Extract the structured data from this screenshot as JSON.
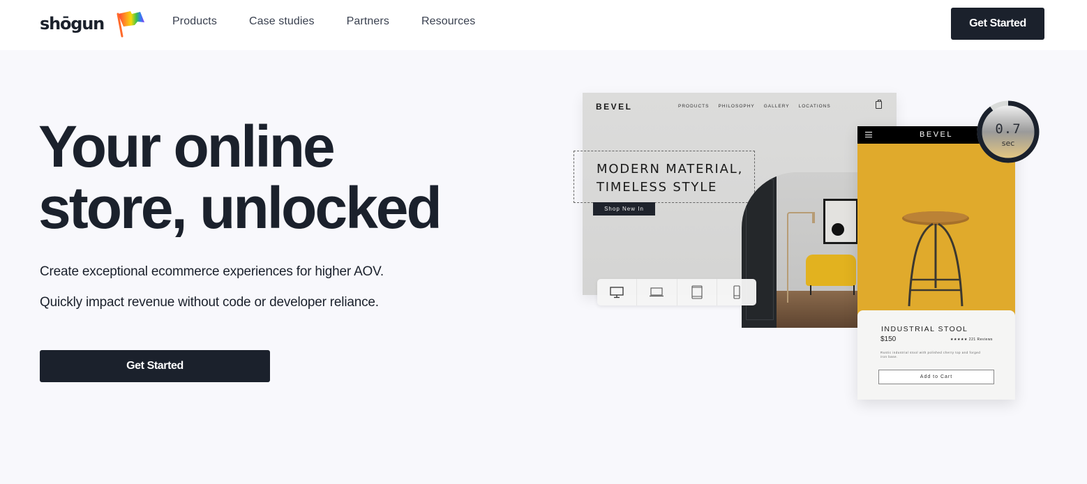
{
  "header": {
    "logo_text": "shōgun",
    "nav": [
      "Products",
      "Case studies",
      "Partners",
      "Resources"
    ],
    "cta_label": "Get Started"
  },
  "hero": {
    "title_line1": "Your online",
    "title_line2": "store, unlocked",
    "subtitle1": "Create exceptional ecommerce experiences for higher AOV.",
    "subtitle2": "Quickly impact revenue without code or developer reliance.",
    "cta_label": "Get Started"
  },
  "desktop_preview": {
    "brand": "BEVEL",
    "nav": [
      "PRODUCTS",
      "PHILOSOPHY",
      "GALLERY",
      "LOCATIONS"
    ],
    "headline_line1": "MODERN MATERIAL,",
    "headline_line2": "TIMELESS STYLE",
    "button_label": "Shop New In",
    "devices": [
      "desktop-icon",
      "laptop-icon",
      "tablet-icon",
      "mobile-icon"
    ]
  },
  "mobile_preview": {
    "brand": "BEVEL",
    "product_name": "INDUSTRIAL STOOL",
    "price": "$150",
    "rating": "★★★★★ 221 Reviews",
    "description": "Rustic industrial stool with polished cherry top and forged iron base.",
    "button_label": "Add to Cart"
  },
  "speed_gauge": {
    "value": "0.7",
    "unit": "sec",
    "fill_fraction": 0.9
  },
  "colors": {
    "primary": "#1b212c",
    "background": "#f8f8fc",
    "accent_yellow": "#e0aa2c"
  }
}
